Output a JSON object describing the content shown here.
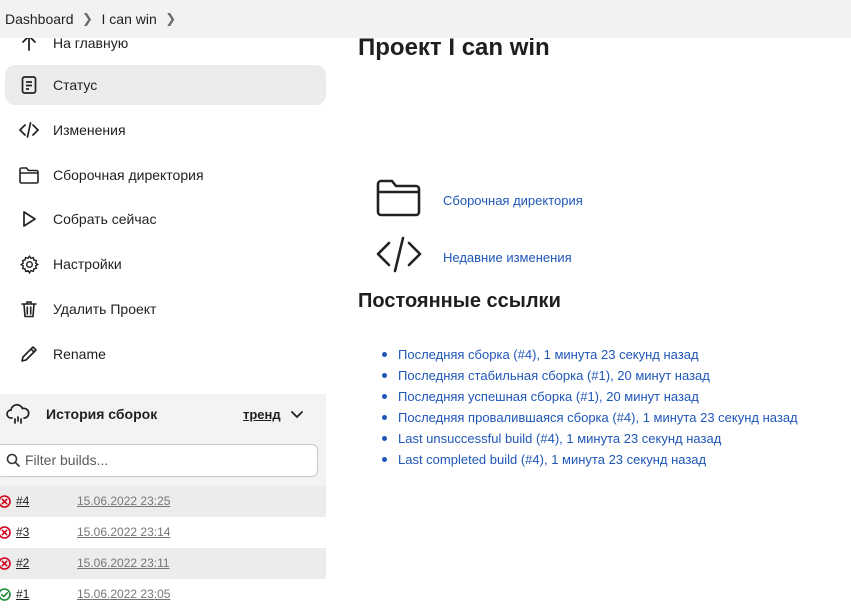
{
  "breadcrumb": {
    "items": [
      {
        "label": "Dashboard"
      },
      {
        "label": "I can win"
      }
    ]
  },
  "sidebar": {
    "items": [
      {
        "label": "На главную",
        "icon": "arrow-up-icon"
      },
      {
        "label": "Статус",
        "icon": "document-icon",
        "active": true
      },
      {
        "label": "Изменения",
        "icon": "code-icon"
      },
      {
        "label": "Сборочная директория",
        "icon": "folder-icon"
      },
      {
        "label": "Собрать сейчас",
        "icon": "play-icon"
      },
      {
        "label": "Настройки",
        "icon": "gear-icon"
      },
      {
        "label": "Удалить Проект",
        "icon": "trash-icon"
      },
      {
        "label": "Rename",
        "icon": "pencil-icon"
      }
    ]
  },
  "history": {
    "title": "История сборок",
    "trend_label": "тренд",
    "filter_placeholder": "Filter builds...",
    "builds": [
      {
        "number": "#4",
        "date": "15.06.2022 23:25",
        "status": "failed"
      },
      {
        "number": "#3",
        "date": "15.06.2022 23:14",
        "status": "failed"
      },
      {
        "number": "#2",
        "date": "15.06.2022 23:11",
        "status": "failed"
      },
      {
        "number": "#1",
        "date": "15.06.2022 23:05",
        "status": "success"
      }
    ]
  },
  "main": {
    "title": "Проект I can win",
    "links": [
      {
        "label": "Сборочная директория",
        "icon": "folder-icon"
      },
      {
        "label": "Недавние изменения",
        "icon": "code-icon"
      }
    ],
    "permalinks_title": "Постоянные ссылки",
    "permalinks": [
      "Последняя сборка (#4), 1 минута 23 секунд назад",
      "Последняя стабильная сборка (#1), 20 минут назад",
      "Последняя успешная сборка (#1), 20 минут назад",
      "Последняя провалившаяся сборка (#4), 1 минута 23 секунд назад",
      "Last unsuccessful build (#4), 1 минута 23 секунд назад",
      "Last completed build (#4), 1 минута 23 секунд назад"
    ]
  },
  "colors": {
    "link": "#1f57b8",
    "failed": "#d0021b",
    "success": "#1e8a3b",
    "sidebar_active": "#ececec"
  }
}
